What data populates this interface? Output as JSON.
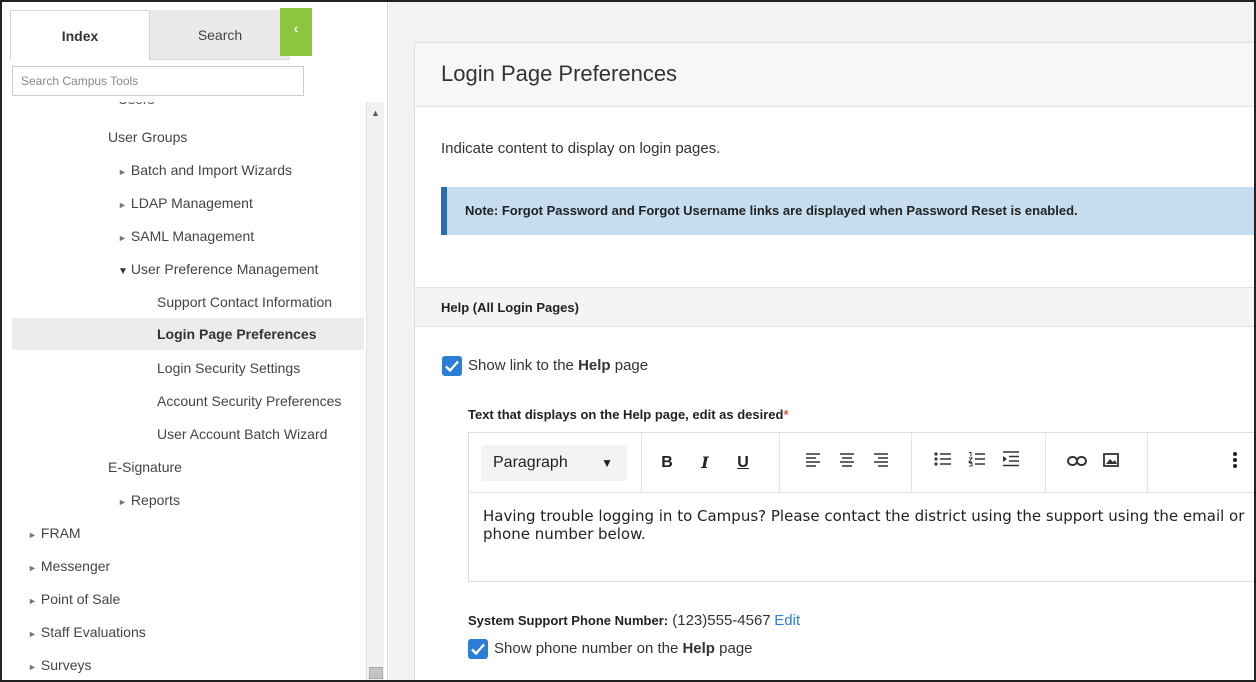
{
  "sidebar": {
    "tabs": {
      "index": "Index",
      "search": "Search",
      "collapse": "‹"
    },
    "search_placeholder": "Search Campus Tools",
    "cut_item": "Users",
    "items": [
      {
        "label": "User Groups",
        "arrow": ""
      },
      {
        "label": "Batch and Import Wizards",
        "arrow": "►"
      },
      {
        "label": "LDAP Management",
        "arrow": "►"
      },
      {
        "label": "SAML Management",
        "arrow": "►"
      },
      {
        "label": "User Preference Management",
        "arrow": "▼"
      },
      {
        "label": "Support Contact Information",
        "arrow": ""
      },
      {
        "label": "Login Page Preferences",
        "arrow": ""
      },
      {
        "label": "Login Security Settings",
        "arrow": ""
      },
      {
        "label": "Account Security Preferences",
        "arrow": ""
      },
      {
        "label": "User Account Batch Wizard",
        "arrow": ""
      },
      {
        "label": "E-Signature",
        "arrow": ""
      },
      {
        "label": "Reports",
        "arrow": "►"
      },
      {
        "label": "FRAM",
        "arrow": "►"
      },
      {
        "label": "Messenger",
        "arrow": "►"
      },
      {
        "label": "Point of Sale",
        "arrow": "►"
      },
      {
        "label": "Staff Evaluations",
        "arrow": "►"
      },
      {
        "label": "Surveys",
        "arrow": "►"
      }
    ]
  },
  "main": {
    "title": "Login Page Preferences",
    "description": "Indicate content to display on login pages.",
    "note": {
      "prefix": "Note: ",
      "bold1": "Forgot Password",
      "mid": " and ",
      "bold2": "Forgot Username",
      "suffix": " links are displayed when Password Reset is enabled."
    },
    "section_title": "Help (All Login Pages)",
    "help_checkbox": {
      "prefix": "Show link to the ",
      "bold": "Help",
      "suffix": " page",
      "checked": true
    },
    "text_label": "Text that displays on the Help page, edit as desired",
    "required_mark": "*",
    "editor": {
      "paragraph": "Paragraph",
      "caret": "▼",
      "bold": "B",
      "italic": "I",
      "underline": "U",
      "content": "Having trouble logging in to Campus? Please contact the district using the support using the email or phone number below."
    },
    "phone": {
      "label": "System Support Phone Number:",
      "value": " (123)555-4567",
      "edit": "Edit"
    },
    "phone_checkbox": {
      "prefix": "Show phone number on the ",
      "bold": "Help",
      "suffix": " page",
      "checked": true
    }
  },
  "colors": {
    "accent": "#2a7fd4",
    "collapse_green": "#8cc63e",
    "note_bg": "#c5ddee",
    "note_border": "#2b6cb0"
  }
}
